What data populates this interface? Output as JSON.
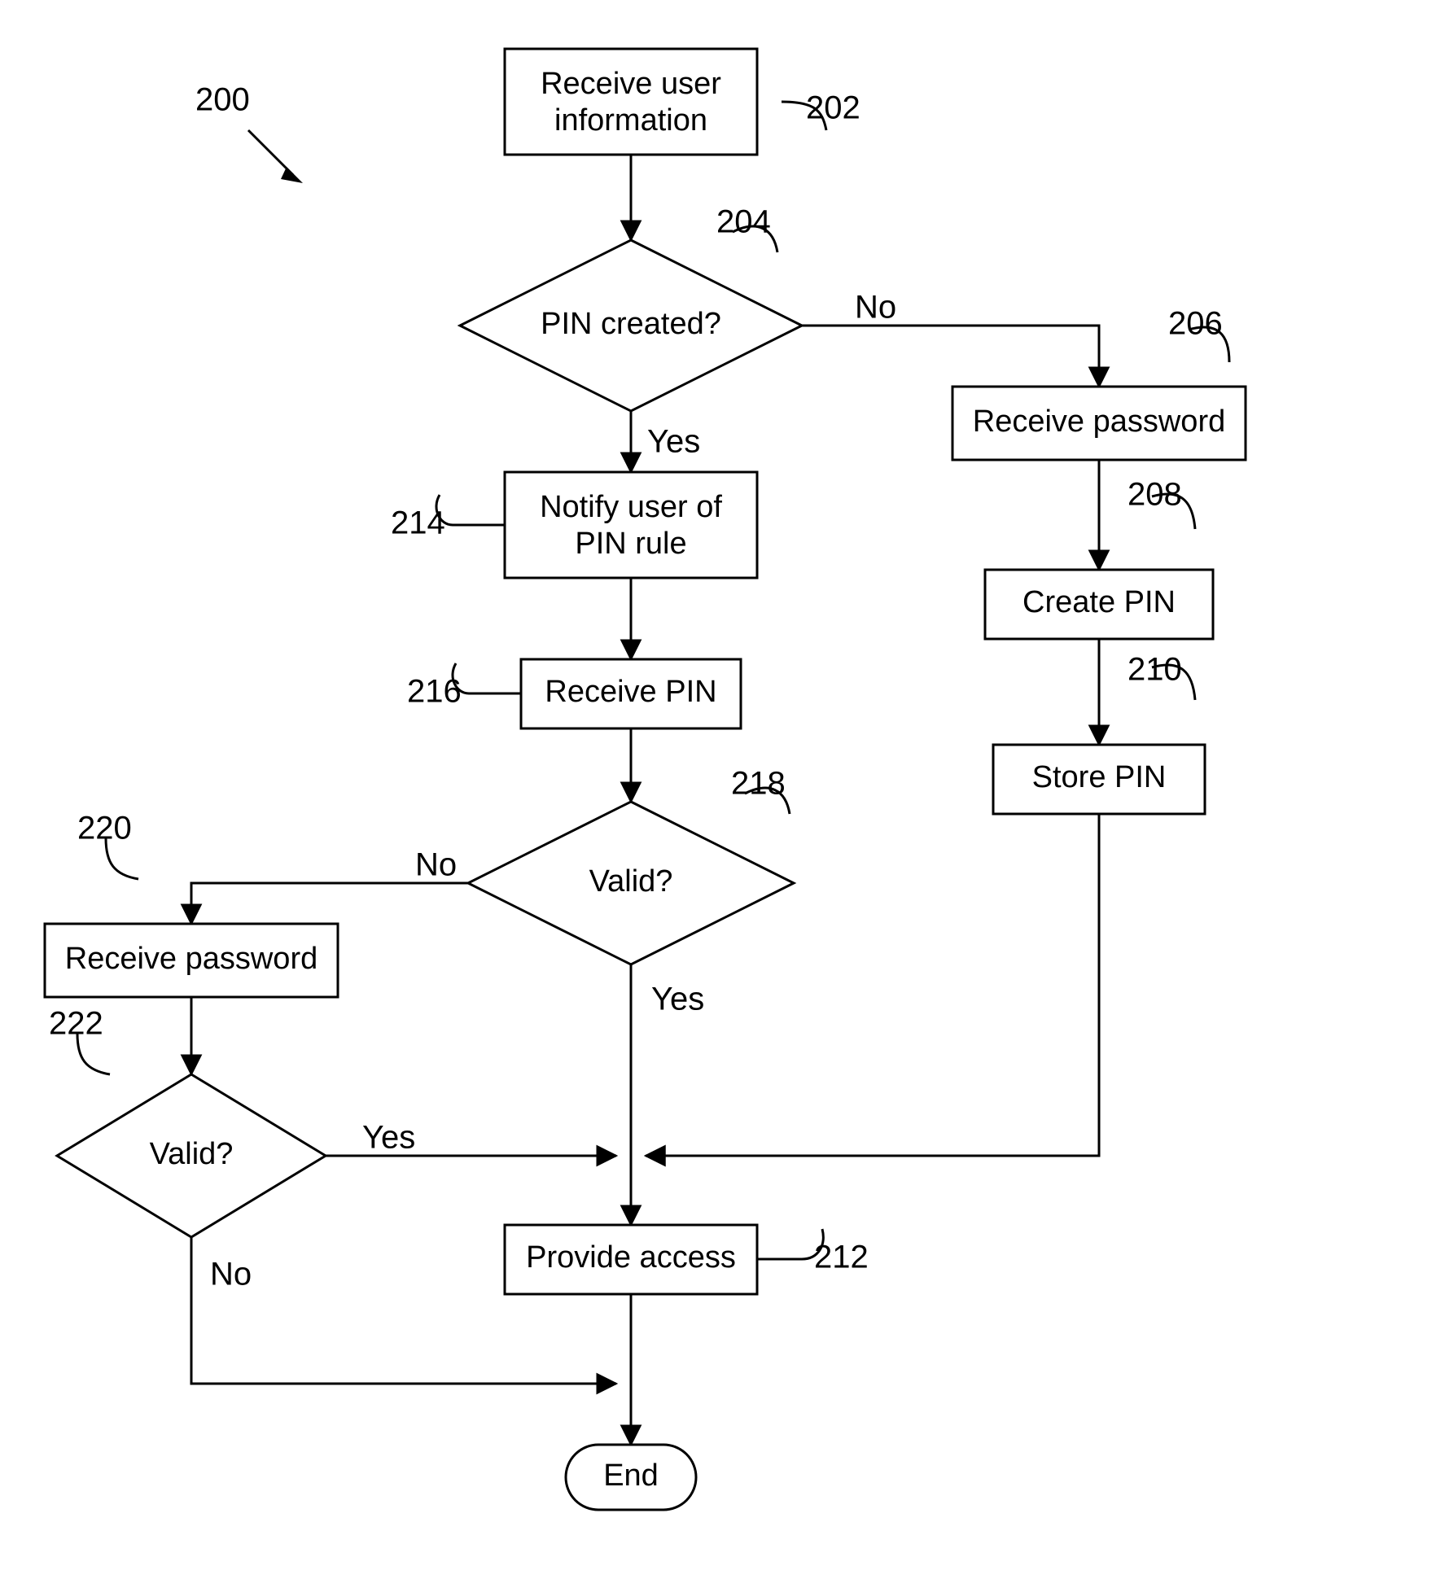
{
  "figure_ref": "200",
  "nodes": {
    "n202": {
      "ref": "202",
      "text": [
        "Receive user",
        "information"
      ]
    },
    "n204": {
      "ref": "204",
      "text": [
        "PIN created?"
      ],
      "yes": "Yes",
      "no": "No"
    },
    "n206": {
      "ref": "206",
      "text": [
        "Receive password"
      ]
    },
    "n208": {
      "ref": "208",
      "text": [
        "Create PIN"
      ]
    },
    "n210": {
      "ref": "210",
      "text": [
        "Store PIN"
      ]
    },
    "n212": {
      "ref": "212",
      "text": [
        "Provide access"
      ]
    },
    "n214": {
      "ref": "214",
      "text": [
        "Notify user of",
        "PIN rule"
      ]
    },
    "n216": {
      "ref": "216",
      "text": [
        "Receive PIN"
      ]
    },
    "n218": {
      "ref": "218",
      "text": [
        "Valid?"
      ],
      "yes": "Yes",
      "no": "No"
    },
    "n220": {
      "ref": "220",
      "text": [
        "Receive password"
      ]
    },
    "n222": {
      "ref": "222",
      "text": [
        "Valid?"
      ],
      "yes": "Yes",
      "no": "No"
    },
    "end": {
      "text": [
        "End"
      ]
    }
  }
}
